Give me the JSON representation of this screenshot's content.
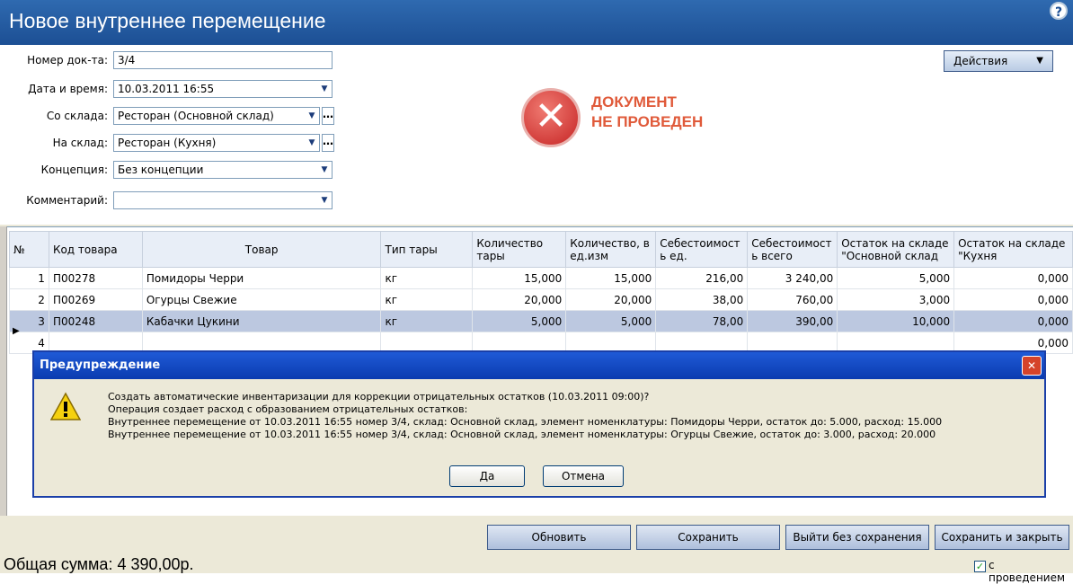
{
  "window": {
    "title": "Новое внутреннее перемещение",
    "help_icon": "?"
  },
  "form": {
    "doc_number_label": "Номер док-та:",
    "doc_number": "3/4",
    "datetime_label": "Дата и время:",
    "datetime": "10.03.2011 16:55",
    "from_label": "Со склада:",
    "from": "Ресторан (Основной склад)",
    "to_label": "На склад:",
    "to": "Ресторан (Кухня)",
    "concept_label": "Концепция:",
    "concept": "Без концепции",
    "comment_label": "Комментарий:",
    "comment": ""
  },
  "actions_button": "Действия",
  "status": {
    "line1": "ДОКУМЕНТ",
    "line2": "НЕ ПРОВЕДЕН"
  },
  "table": {
    "headers": [
      "№",
      "Код товара",
      "Товар",
      "Тип тары",
      "Количество тары",
      "Количество, в ед.изм",
      "Себестоимост ь ед.",
      "Себестоимост ь всего",
      "Остаток на складе \"Основной склад",
      "Остаток на складе \"Кухня"
    ],
    "rows": [
      [
        "1",
        "П00278",
        "Помидоры Черри",
        "кг",
        "15,000",
        "15,000",
        "216,00",
        "3 240,00",
        "5,000",
        "0,000"
      ],
      [
        "2",
        "П00269",
        "Огурцы Свежие",
        "кг",
        "20,000",
        "20,000",
        "38,00",
        "760,00",
        "3,000",
        "0,000"
      ],
      [
        "3",
        "П00248",
        "Кабачки Цукини",
        "кг",
        "5,000",
        "5,000",
        "78,00",
        "390,00",
        "10,000",
        "0,000"
      ],
      [
        "4",
        "",
        "",
        "",
        "",
        "",
        "",
        "",
        "",
        "0,000"
      ]
    ]
  },
  "dialog": {
    "title": "Предупреждение",
    "line1": "Создать автоматические инвентаризации для коррекции отрицательных остатков (10.03.2011 09:00)?",
    "line2": "Операция создает расход с образованием отрицательных остатков:",
    "line3": "Внутреннее перемещение от 10.03.2011 16:55 номер 3/4, склад: Основной склад, элемент номенклатуры: Помидоры Черри, остаток до: 5.000, расход: 15.000",
    "line4": "Внутреннее перемещение от 10.03.2011 16:55 номер 3/4, склад: Основной склад, элемент номенклатуры: Огурцы Свежие, остаток до: 3.000, расход: 20.000",
    "yes": "Да",
    "cancel": "Отмена"
  },
  "bottom": {
    "refresh": "Обновить",
    "save": "Сохранить",
    "exit": "Выйти без сохранения",
    "save_close": "Сохранить и закрыть",
    "total": "Общая сумма: 4 390,00р.",
    "post_label": "с проведением",
    "post_checked": "✓"
  }
}
